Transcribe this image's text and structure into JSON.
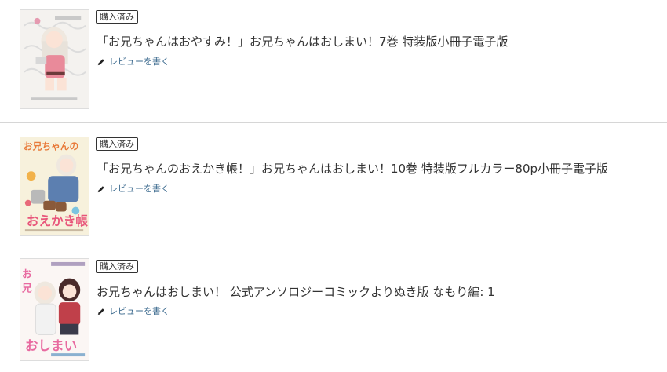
{
  "colors": {
    "link": "#3d6b8f",
    "text": "#333333",
    "divider": "#d6d6d6"
  },
  "items": [
    {
      "badge": "購入済み",
      "title": "「お兄ちゃんはおやすみ！」お兄ちゃんはおしまい！7巻 特装版小冊子電子版",
      "review_label": "レビューを書く",
      "icon": "pencil-icon"
    },
    {
      "badge": "購入済み",
      "title": "「お兄ちゃんのおえかき帳！」お兄ちゃんはおしまい！10巻 特装版フルカラー80p小冊子電子版",
      "review_label": "レビューを書く",
      "icon": "pencil-icon"
    },
    {
      "badge": "購入済み",
      "title": "お兄ちゃんはおしまい！ 公式アンソロジーコミックよりぬき版 なもり編: 1",
      "review_label": "レビューを書く",
      "icon": "pencil-icon"
    }
  ]
}
